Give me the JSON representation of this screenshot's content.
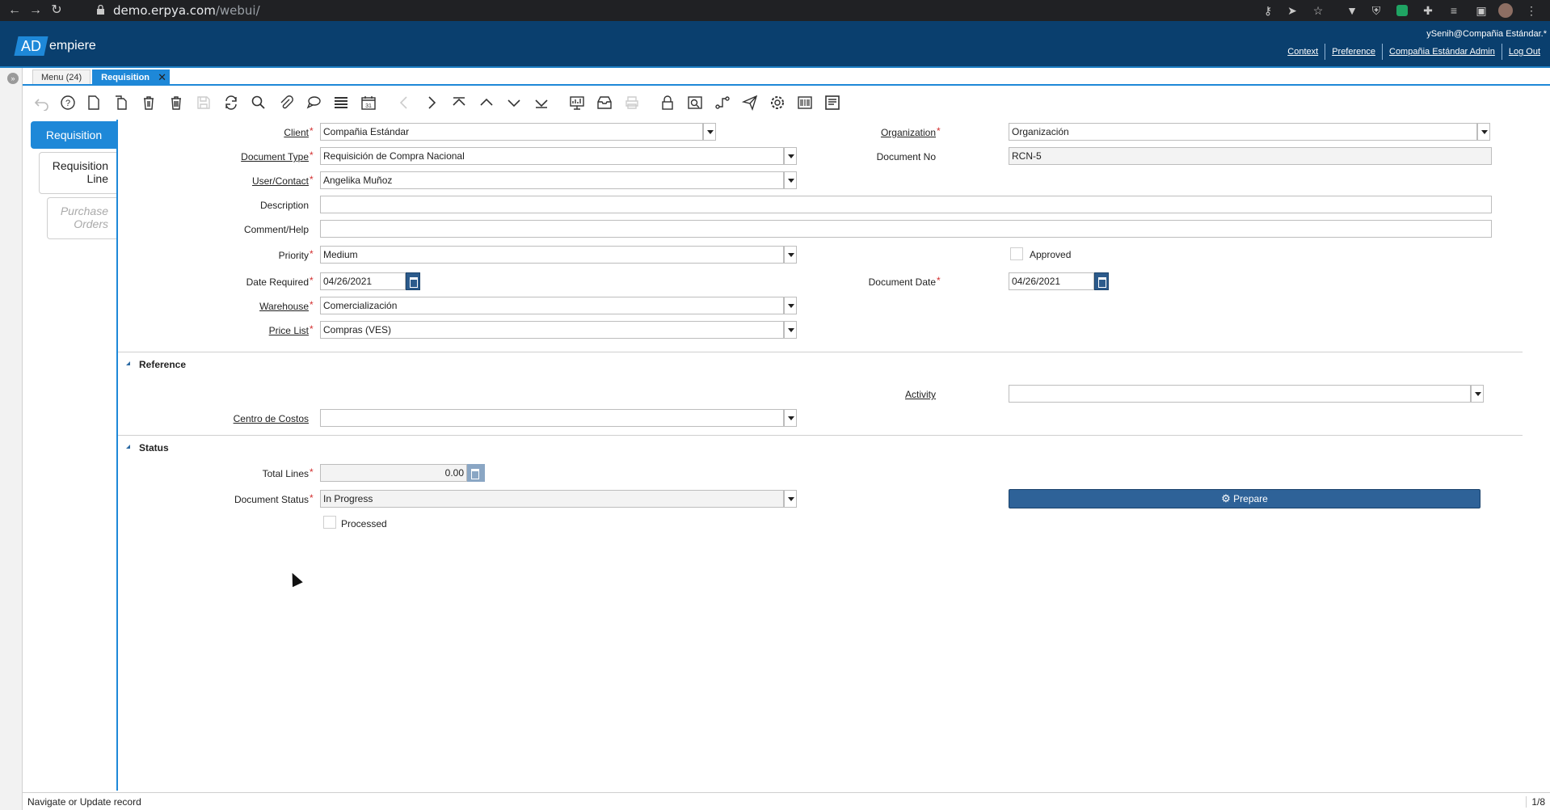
{
  "browser": {
    "url_host": "demo.erpya.com",
    "url_path": "/webui/"
  },
  "header": {
    "logo_ad": "AD",
    "logo_rest": "empiere",
    "user": "ySenih@Compañia Estándar.*",
    "links": {
      "context": "Context",
      "preference": "Preference",
      "role": "Compañia Estándar Admin",
      "logout": "Log Out"
    }
  },
  "window_tabs": {
    "menu": "Menu (24)",
    "requisition": "Requisition"
  },
  "vtabs": {
    "requisition": "Requisition",
    "requisition_line": "Requisition Line",
    "purchase_orders": "Purchase Orders"
  },
  "form": {
    "client": {
      "label": "Client",
      "value": "Compañia Estándar"
    },
    "organization": {
      "label": "Organization",
      "value": "Organización"
    },
    "document_type": {
      "label": "Document Type",
      "value": "Requisición de Compra Nacional"
    },
    "document_no": {
      "label": "Document No",
      "value": "RCN-5"
    },
    "user_contact": {
      "label": "User/Contact",
      "value": "Angelika Muñoz"
    },
    "description": {
      "label": "Description",
      "value": ""
    },
    "comment_help": {
      "label": "Comment/Help",
      "value": ""
    },
    "priority": {
      "label": "Priority",
      "value": "Medium"
    },
    "approved": {
      "label": "Approved",
      "checked": false
    },
    "date_required": {
      "label": "Date Required",
      "value": "04/26/2021"
    },
    "document_date": {
      "label": "Document Date",
      "value": "04/26/2021"
    },
    "warehouse": {
      "label": "Warehouse",
      "value": "Comercialización"
    },
    "price_list": {
      "label": "Price List",
      "value": "Compras (VES)"
    }
  },
  "reference": {
    "title": "Reference",
    "activity": {
      "label": "Activity",
      "value": ""
    },
    "cost_center": {
      "label": "Centro de Costos",
      "value": ""
    }
  },
  "status": {
    "title": "Status",
    "total_lines": {
      "label": "Total Lines",
      "value": "0.00"
    },
    "document_status": {
      "label": "Document Status",
      "value": "In Progress"
    },
    "processed": {
      "label": "Processed",
      "checked": false
    },
    "prepare_button": "Prepare"
  },
  "statusbar": {
    "message": "Navigate or Update record",
    "page": "1/8"
  },
  "toolbar_icons": [
    "undo-icon",
    "help-icon",
    "new-record-icon",
    "copy-record-icon",
    "delete-icon",
    "delete-selection-icon",
    "save-icon",
    "refresh-icon",
    "find-icon",
    "attachment-icon",
    "chat-icon",
    "grid-toggle-icon",
    "calendar-icon",
    "previous-icon",
    "next-icon",
    "first-record-icon",
    "parent-record-icon",
    "detail-record-icon",
    "last-record-icon",
    "report-icon",
    "archive-icon",
    "print-icon",
    "lock-icon",
    "zoom-across-icon",
    "workflow-icon",
    "request-icon",
    "process-icon",
    "product-info-icon",
    "export-icon"
  ]
}
